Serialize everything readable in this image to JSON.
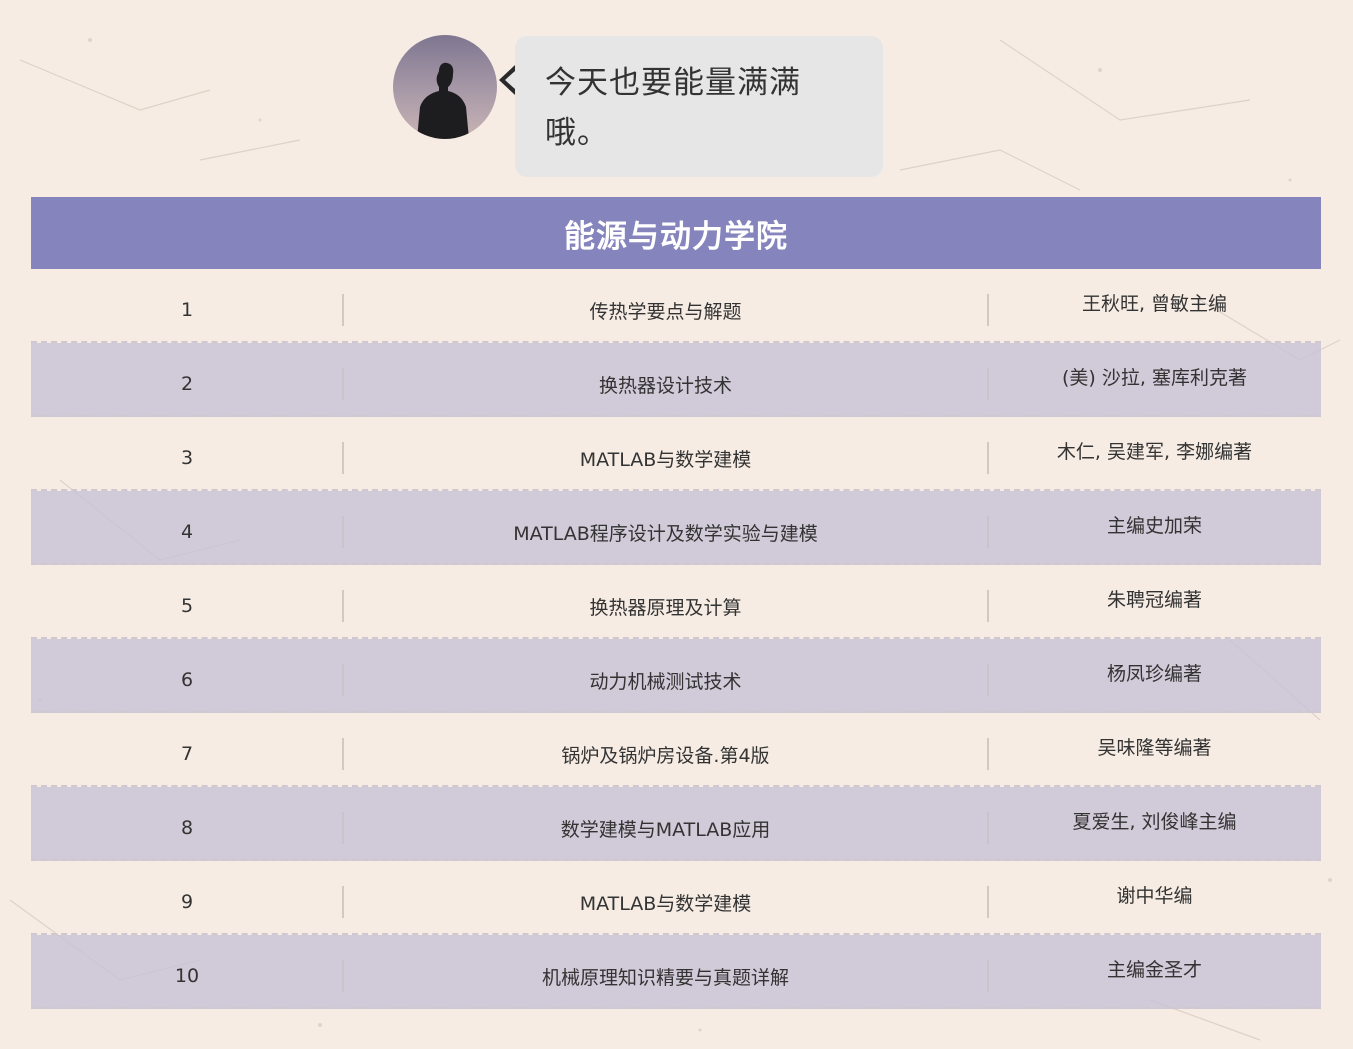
{
  "greeting": {
    "avatar_icon": "person-silhouette-icon",
    "message": "今天也要能量满满哦。"
  },
  "table": {
    "header": "能源与动力学院",
    "header_color": "#8584bd",
    "rows": [
      {
        "num": "1",
        "title": "传热学要点与解题",
        "author": "王秋旺, 曾敏主编"
      },
      {
        "num": "2",
        "title": "换热器设计技术",
        "author": "(美) 沙拉, 塞库利克著"
      },
      {
        "num": "3",
        "title": "MATLAB与数学建模",
        "author": "木仁, 吴建军, 李娜编著"
      },
      {
        "num": "4",
        "title": "MATLAB程序设计及数学实验与建模",
        "author": "主编史加荣"
      },
      {
        "num": "5",
        "title": "换热器原理及计算",
        "author": "朱聘冠编著"
      },
      {
        "num": "6",
        "title": "动力机械测试技术",
        "author": "杨凤珍编著"
      },
      {
        "num": "7",
        "title": "锅炉及锅炉房设备.第4版",
        "author": "吴味隆等编著"
      },
      {
        "num": "8",
        "title": "数学建模与MATLAB应用",
        "author": "夏爱生, 刘俊峰主编"
      },
      {
        "num": "9",
        "title": "MATLAB与数学建模",
        "author": "谢中华编"
      },
      {
        "num": "10",
        "title": "机械原理知识精要与真题详解",
        "author": "主编金圣才"
      }
    ]
  }
}
